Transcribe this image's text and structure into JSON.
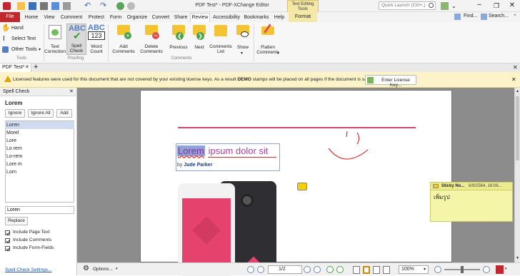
{
  "titlebar": {
    "title": "PDF Test* - PDF-XChange Editor",
    "context_tab": "Text Editing\nTools",
    "quick_launch_placeholder": "Quick Launch (Ctrl+.)"
  },
  "menubar": {
    "items": [
      "File",
      "Home",
      "View",
      "Comment",
      "Protect",
      "Form",
      "Organize",
      "Convert",
      "Share",
      "Review",
      "Accessibility",
      "Bookmarks",
      "Help",
      "Format"
    ],
    "active": "Review",
    "find_label": "Find...",
    "search_label": "Search..."
  },
  "ribbon": {
    "tools": {
      "hand": "Hand",
      "select_text": "Select Text",
      "other_tools": "Other Tools",
      "group": "Tools"
    },
    "proofing": {
      "text_correction": "Text\nCorrection",
      "spell_check": "Spell\nCheck",
      "word_count": "Word\nCount",
      "abc": "ABC",
      "num": "123",
      "group": "Proofing"
    },
    "comments": {
      "add": "Add\nComments",
      "delete": "Delete\nComments",
      "previous": "Previous",
      "next": "Next",
      "list": "Comments\nList",
      "show": "Show",
      "group": "Comments"
    },
    "flatten": {
      "label": "Flatten\nComments"
    }
  },
  "doctabs": {
    "tab": "PDF Test*"
  },
  "notice": {
    "text_before": "Licensed features were used for this document that are not covered by your existing license keys. As a result ",
    "demo": "DEMO",
    "text_after": " stamps will be placed on all pages if the document is saved.",
    "button": "Enter License Key..."
  },
  "spellcheck": {
    "panel_title": "Spell Check",
    "word": "Lorem",
    "ignore": "Ignore",
    "ignore_all": "Ignore All",
    "add": "Add",
    "suggestions": [
      "Loren",
      "Morel",
      "Lore",
      "Lo rem",
      "Lo-rem",
      "Lore m",
      "Lorn"
    ],
    "selected_index": 0,
    "replace_value": "Loren",
    "replace": "Replace",
    "options": [
      {
        "label": "Include Page Text",
        "checked": true
      },
      {
        "label": "Include Comments",
        "checked": true
      },
      {
        "label": "Include Form-Fields",
        "checked": true
      }
    ],
    "settings_link": "Spell Check Settings..."
  },
  "document": {
    "title_word1": "Lorem",
    "title_rest": " ipsum dolor sit",
    "byline_prefix": "by ",
    "author": "Jude Parker"
  },
  "sticky": {
    "title": "Sticky No...",
    "date": "6/9/2564, 16:06...",
    "body": "เพิ่มรูป"
  },
  "statusbar": {
    "options": "Options...",
    "page": "1/2",
    "zoom": "100%"
  },
  "colors": {
    "accent": "#c0392b",
    "ribbon_active": "#dcdcdc",
    "title_text": "#8a2b9c",
    "highlight": "#8ea3d6",
    "sticky": "#f5f5a8",
    "notice": "#fdf3c8"
  }
}
